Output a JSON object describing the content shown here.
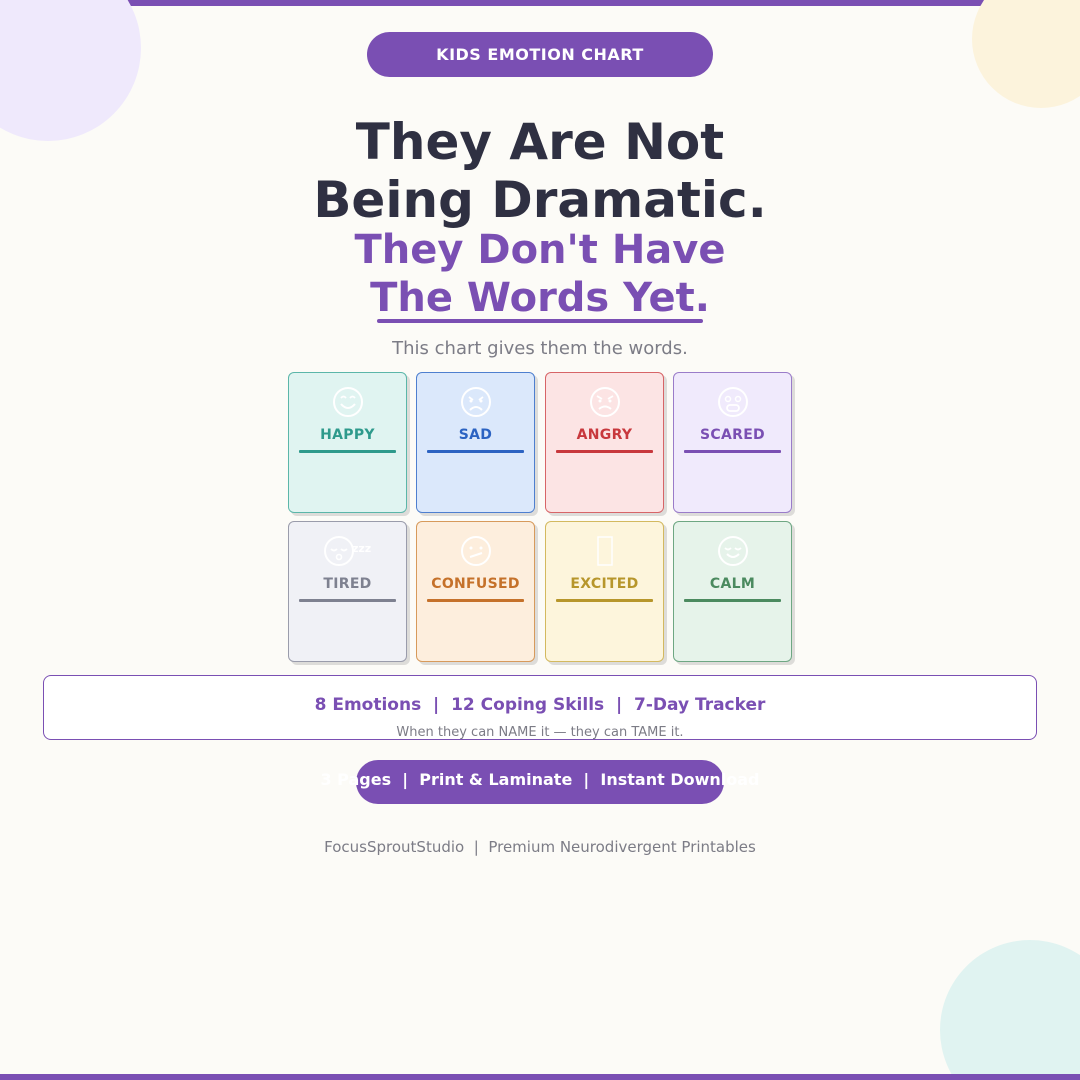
{
  "badge": "KIDS EMOTION CHART",
  "headline": {
    "line1": "They Are Not",
    "line2": "Being Dramatic."
  },
  "subheadline": {
    "line1": "They Don't Have",
    "line2": "The Words Yet."
  },
  "tagline": "This chart gives them the words.",
  "emotions": [
    {
      "label": "HAPPY",
      "icon": "happy-face-icon",
      "color": "#2e9a8c",
      "bg": "#e0f4f1",
      "border": "#5bb6a9"
    },
    {
      "label": "SAD",
      "icon": "sad-face-icon",
      "color": "#2c63c2",
      "bg": "#dbe8fb",
      "border": "#4e7fcf"
    },
    {
      "label": "ANGRY",
      "icon": "angry-face-icon",
      "color": "#c8383d",
      "bg": "#fce4e4",
      "border": "#d76467"
    },
    {
      "label": "SCARED",
      "icon": "scared-face-icon",
      "color": "#7a4fb3",
      "bg": "#f0eafc",
      "border": "#9a7cc9"
    },
    {
      "label": "TIRED",
      "icon": "tired-face-icon",
      "color": "#7e8190",
      "bg": "#f0f1f6",
      "border": "#9a9cab"
    },
    {
      "label": "CONFUSED",
      "icon": "confused-face-icon",
      "color": "#c5712a",
      "bg": "#fdeedd",
      "border": "#d79a5b"
    },
    {
      "label": "EXCITED",
      "icon": "excited-icon",
      "color": "#b7962b",
      "bg": "#fdf5dc",
      "border": "#d3b95f"
    },
    {
      "label": "CALM",
      "icon": "calm-face-icon",
      "color": "#4b8a5f",
      "bg": "#e6f3ea",
      "border": "#6ea783"
    }
  ],
  "stats": {
    "line": "8 Emotions  |  12 Coping Skills  |  7-Day Tracker",
    "note": "When they can NAME it — they can TAME it."
  },
  "cta": "3 Pages  |  Print & Laminate  |  Instant Download",
  "footer": "FocusSproutStudio  |  Premium Neurodivergent Printables",
  "colors": {
    "accent": "#7a4fb3",
    "text": "#2f3042",
    "muted": "#7c7c86",
    "background": "#fcfbf7"
  }
}
